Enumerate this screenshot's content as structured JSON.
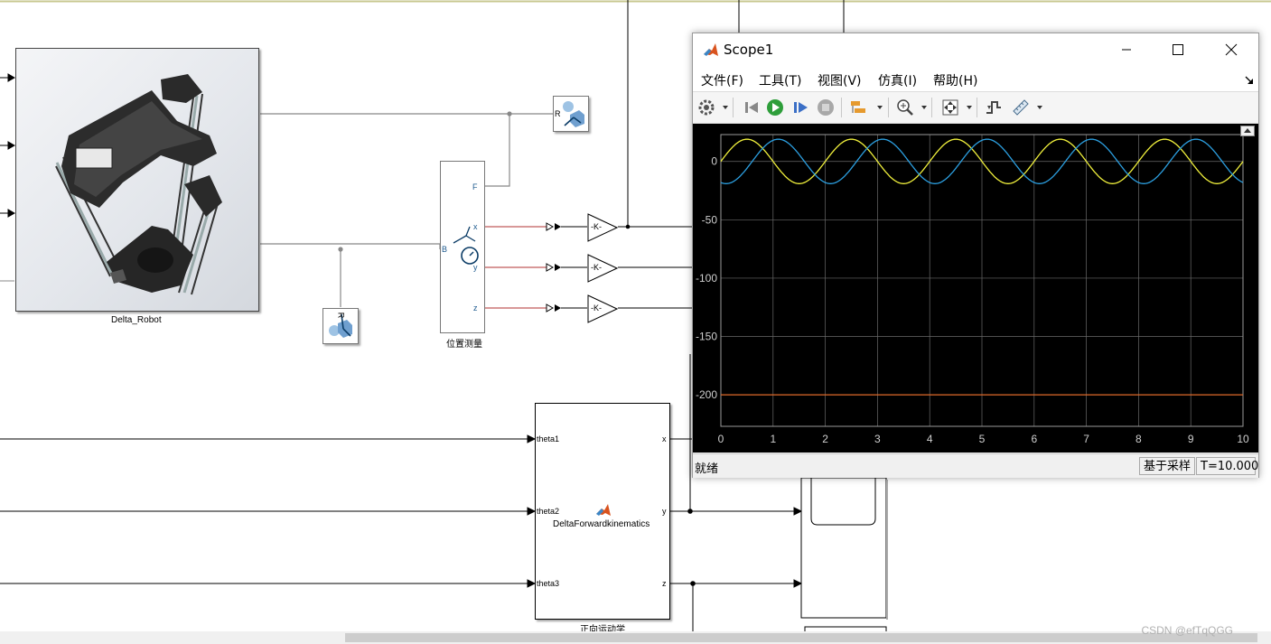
{
  "model": {
    "robot_block_label": "Delta_Robot",
    "sensor_block_label": "位置测量",
    "sensor_ports": {
      "f": "F",
      "x": "x",
      "y": "y",
      "z": "z",
      "b": "B"
    },
    "transform_port_label": "R",
    "gain_label": "-K-",
    "fk_block": {
      "name": "DeltaForwardkinematics",
      "label": "正向运动学",
      "inputs": [
        "theta1",
        "theta2",
        "theta3"
      ],
      "outputs": [
        "x",
        "y",
        "z"
      ]
    }
  },
  "scope": {
    "title": "Scope1",
    "menu": [
      "文件(F)",
      "工具(T)",
      "视图(V)",
      "仿真(I)",
      "帮助(H)"
    ],
    "toolbar_icons": [
      "gear-icon",
      "step-back-icon",
      "run-icon",
      "step-forward-icon",
      "stop-icon",
      "highlight-icon",
      "zoom-icon",
      "autoscale-icon",
      "triggers-icon",
      "measure-icon"
    ],
    "status": "就绪",
    "sample_mode": "基于采样",
    "time": "T=10.000",
    "colors": {
      "yellow": "#f0f03c",
      "blue": "#2c9fe0",
      "orange": "#e06a2a",
      "grid": "#6a6a6a",
      "tick": "#cfcfcf"
    }
  },
  "chart_data": {
    "type": "line",
    "x": [
      0,
      10
    ],
    "xlim": [
      0,
      10
    ],
    "ylim": [
      -227,
      23
    ],
    "xticks": [
      "0",
      "1",
      "2",
      "3",
      "4",
      "5",
      "6",
      "7",
      "8",
      "9",
      "10"
    ],
    "yticks": [
      "0",
      "-50",
      "-100",
      "-150",
      "-200"
    ],
    "ytick_values": [
      0,
      -50,
      -100,
      -150,
      -200
    ],
    "grid": true,
    "series": [
      {
        "color": "yellow",
        "kind": "sine",
        "amplitude": 19,
        "offset": 0,
        "period": 2,
        "phase_shift": 0
      },
      {
        "color": "blue",
        "kind": "sine",
        "amplitude": 19,
        "offset": 0,
        "period": 2,
        "phase_shift": 0.6
      },
      {
        "color": "orange",
        "kind": "constant",
        "offset": -200
      }
    ]
  },
  "watermark": "CSDN @efTqQGG"
}
